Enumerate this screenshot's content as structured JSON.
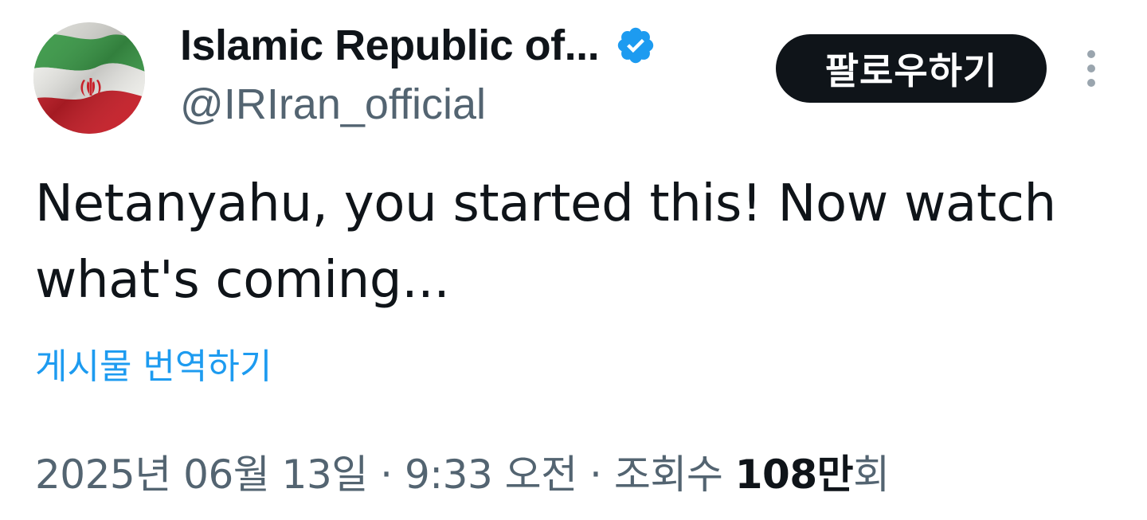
{
  "author": {
    "display_name": "Islamic Republic of...",
    "handle": "@IRIran_official",
    "verified": true,
    "avatar_icon": "iran-flag-icon",
    "verified_icon": "verified-badge-icon"
  },
  "actions": {
    "follow_label": "팔로우하기",
    "more_icon": "more-options-icon"
  },
  "tweet": {
    "text": "Netanyahu, you started this! Now watch what's coming...",
    "translate_label": "게시물 번역하기"
  },
  "meta": {
    "date": "2025년 06월 13일",
    "separator": " · ",
    "time": "9:33 오전",
    "views_prefix": "조회수 ",
    "views_count": "108만",
    "views_suffix": "회"
  },
  "colors": {
    "text_primary": "#0f1419",
    "text_secondary": "#536471",
    "link": "#1d9bf0",
    "button_bg": "#0f1419",
    "button_text": "#ffffff",
    "verified": "#1d9bf0"
  }
}
